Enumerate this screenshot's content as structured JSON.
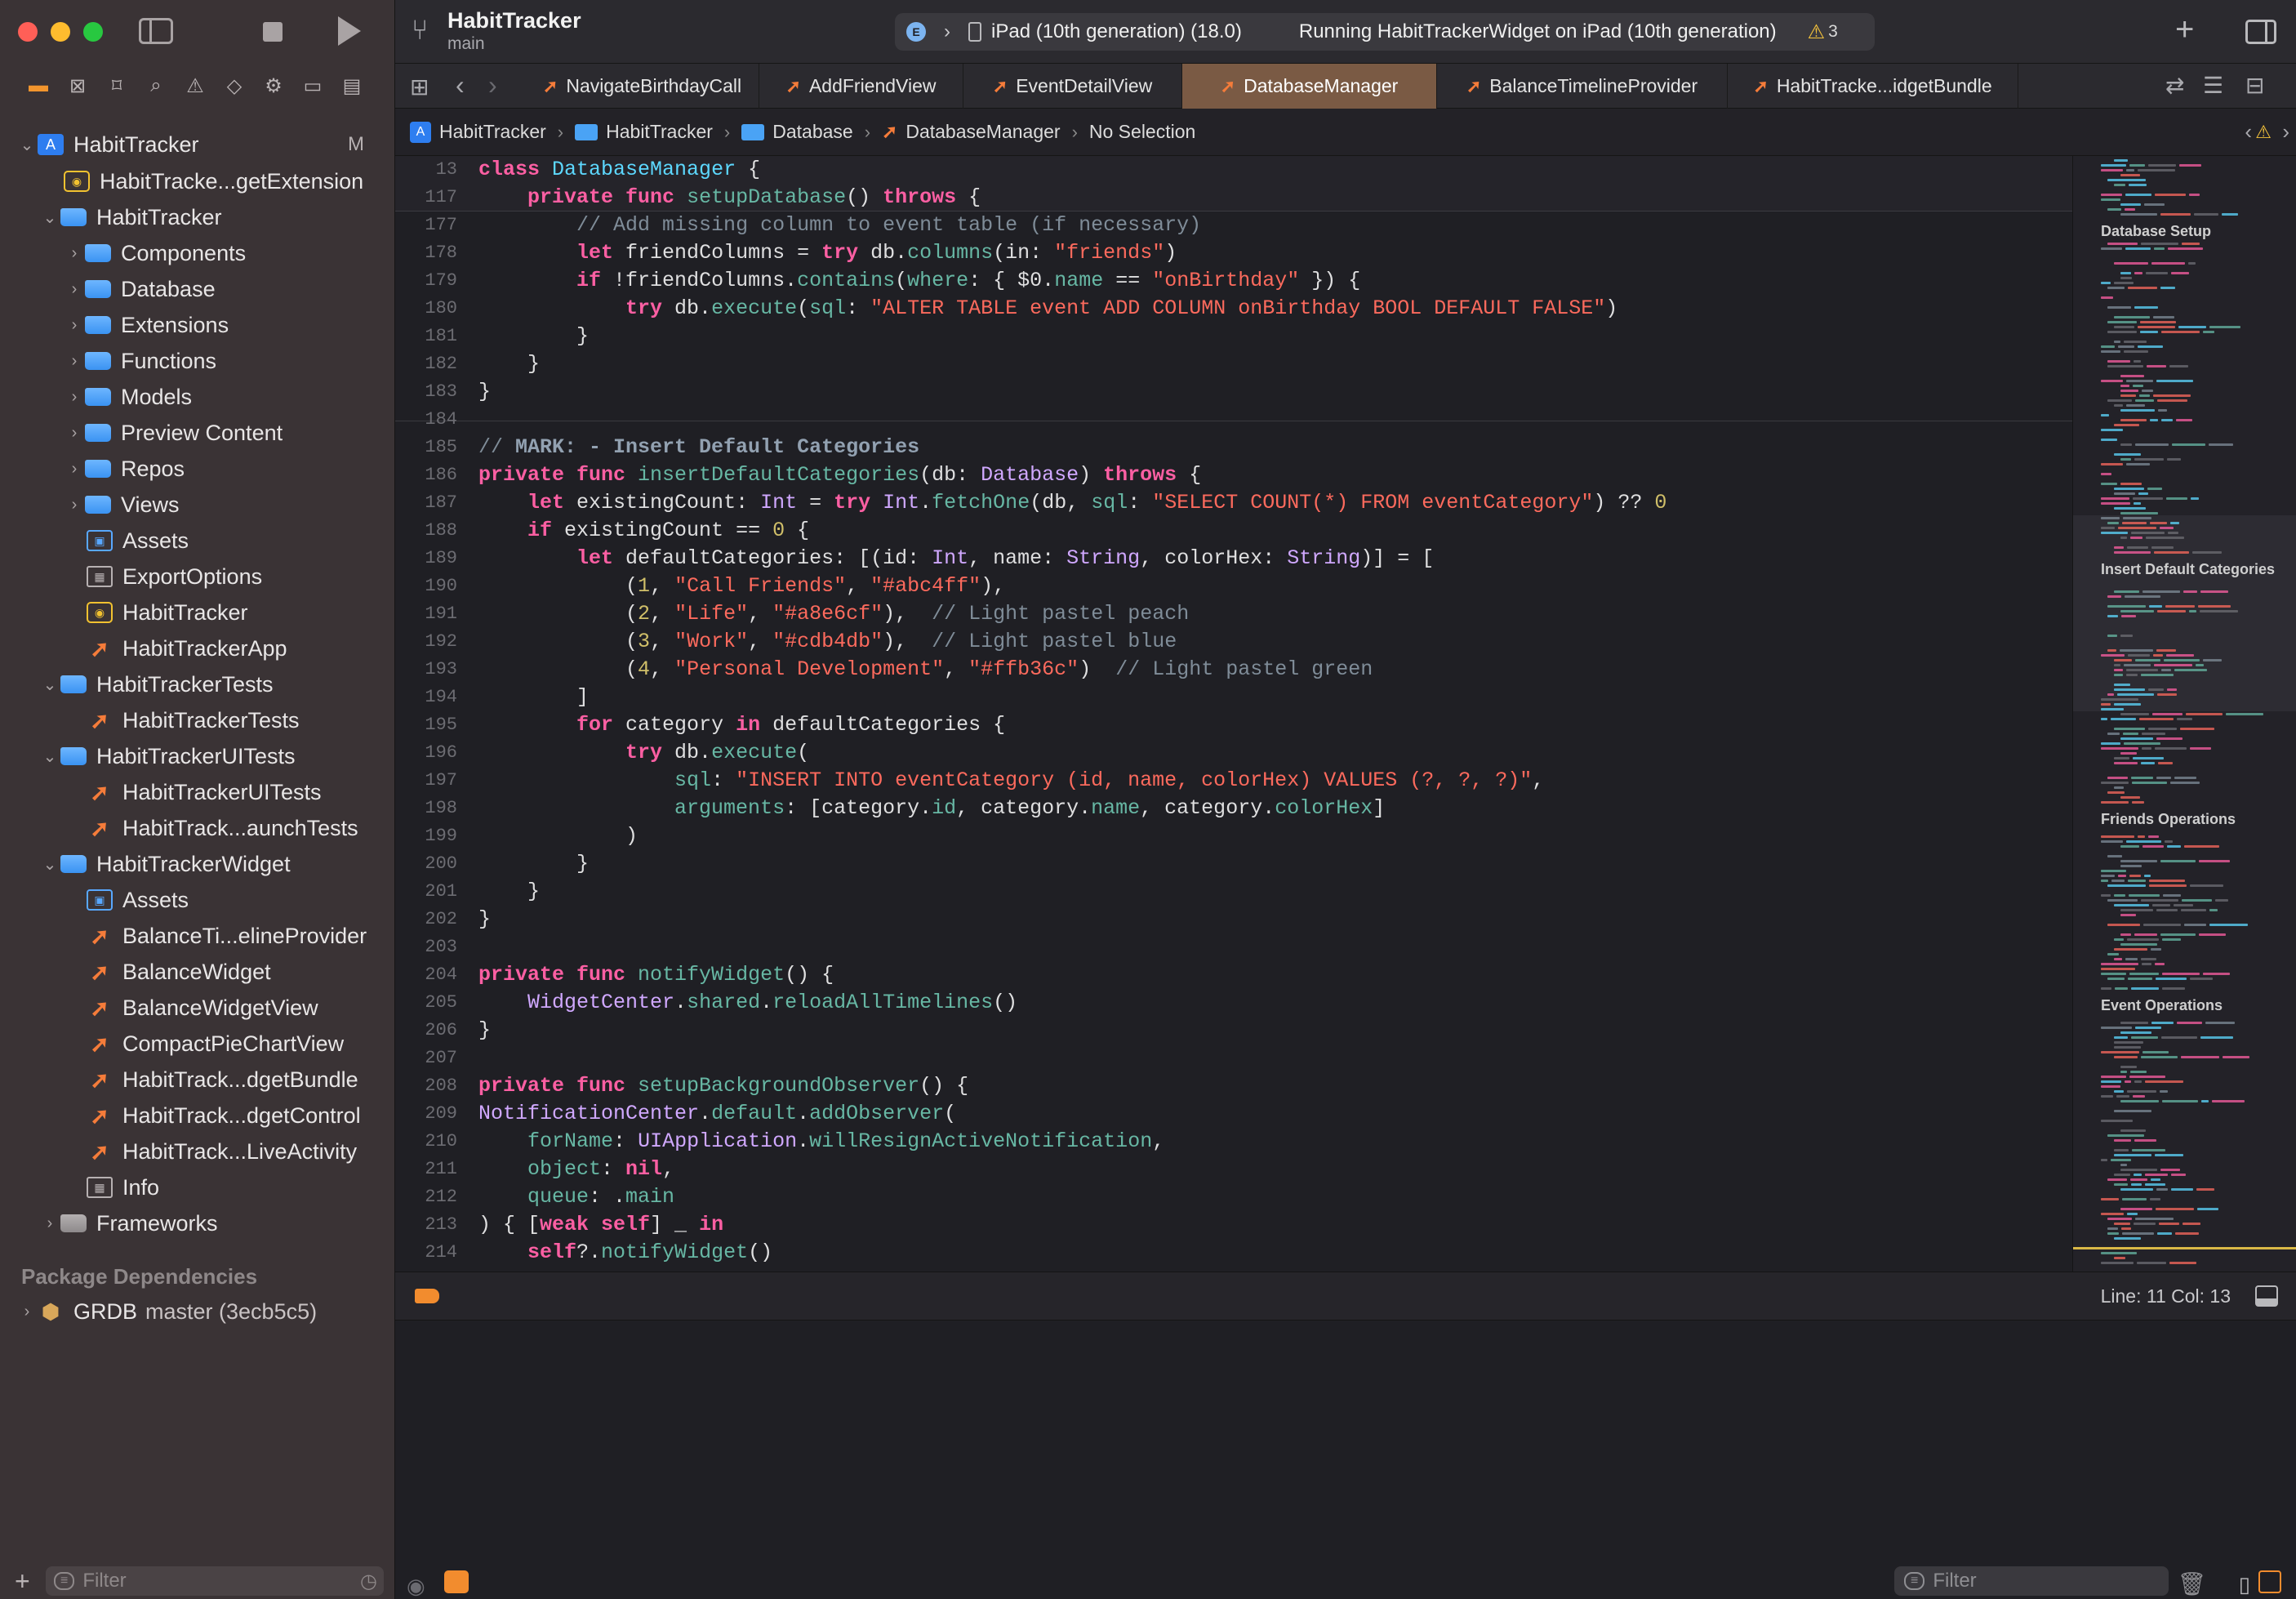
{
  "app": {
    "project_name": "HabitTracker",
    "branch": "main",
    "run_destination": "iPad (10th generation) (18.0)",
    "run_status": "Running HabitTrackerWidget on iPad (10th generation)",
    "warning_count": "3",
    "scheme_badge": "E"
  },
  "tabs": [
    {
      "label": "NavigateBirthdayCall"
    },
    {
      "label": "AddFriendView"
    },
    {
      "label": "EventDetailView"
    },
    {
      "label": "DatabaseManager"
    },
    {
      "label": "BalanceTimelineProvider"
    },
    {
      "label": "HabitTracke...idgetBundle"
    }
  ],
  "breadcrumb": [
    "HabitTracker",
    "HabitTracker",
    "Database",
    "DatabaseManager",
    "No Selection"
  ],
  "sidebar": {
    "items": [
      {
        "label": "HabitTracker",
        "badge": "M"
      },
      {
        "label": "HabitTracke...getExtension"
      },
      {
        "label": "HabitTracker"
      },
      {
        "label": "Components"
      },
      {
        "label": "Database"
      },
      {
        "label": "Extensions"
      },
      {
        "label": "Functions"
      },
      {
        "label": "Models"
      },
      {
        "label": "Preview Content"
      },
      {
        "label": "Repos"
      },
      {
        "label": "Views"
      },
      {
        "label": "Assets"
      },
      {
        "label": "ExportOptions"
      },
      {
        "label": "HabitTracker"
      },
      {
        "label": "HabitTrackerApp"
      },
      {
        "label": "HabitTrackerTests"
      },
      {
        "label": "HabitTrackerTests"
      },
      {
        "label": "HabitTrackerUITests"
      },
      {
        "label": "HabitTrackerUITests"
      },
      {
        "label": "HabitTrack...aunchTests"
      },
      {
        "label": "HabitTrackerWidget"
      },
      {
        "label": "Assets"
      },
      {
        "label": "BalanceTi...elineProvider"
      },
      {
        "label": "BalanceWidget"
      },
      {
        "label": "BalanceWidgetView"
      },
      {
        "label": "CompactPieChartView"
      },
      {
        "label": "HabitTrack...dgetBundle"
      },
      {
        "label": "HabitTrack...dgetControl"
      },
      {
        "label": "HabitTrack...LiveActivity"
      },
      {
        "label": "Info"
      },
      {
        "label": "Frameworks"
      }
    ],
    "package_dependencies_title": "Package Dependencies",
    "package": {
      "name": "GRDB",
      "version": "master (3ecb5c5)"
    },
    "filter_placeholder": "Filter"
  },
  "minimap": {
    "sections": [
      "Database Setup",
      "Insert Default Categories",
      "Friends Operations",
      "Event Operations"
    ]
  },
  "status": {
    "cursor": "Line: 11  Col: 13"
  },
  "debug": {
    "filter_placeholder": "Filter"
  },
  "code": {
    "sticky": [
      {
        "n": "13",
        "text": "class DatabaseManager {"
      },
      {
        "n": "117",
        "text": "    private func setupDatabase() throws {"
      }
    ],
    "lines": [
      {
        "n": "177",
        "text": "        // Add missing column to event table (if necessary)"
      },
      {
        "n": "178",
        "text": "        let friendColumns = try db.columns(in: \"friends\")"
      },
      {
        "n": "179",
        "text": "        if !friendColumns.contains(where: { $0.name == \"onBirthday\" }) {"
      },
      {
        "n": "180",
        "text": "            try db.execute(sql: \"ALTER TABLE event ADD COLUMN onBirthday BOOL DEFAULT FALSE\")"
      },
      {
        "n": "181",
        "text": "        }"
      },
      {
        "n": "182",
        "text": "    }"
      },
      {
        "n": "183",
        "text": "}"
      },
      {
        "n": "184",
        "text": ""
      },
      {
        "n": "185",
        "text": "// MARK: - Insert Default Categories"
      },
      {
        "n": "186",
        "text": "private func insertDefaultCategories(db: Database) throws {"
      },
      {
        "n": "187",
        "text": "    let existingCount: Int = try Int.fetchOne(db, sql: \"SELECT COUNT(*) FROM eventCategory\") ?? 0"
      },
      {
        "n": "188",
        "text": "    if existingCount == 0 {"
      },
      {
        "n": "189",
        "text": "        let defaultCategories: [(id: Int, name: String, colorHex: String)] = ["
      },
      {
        "n": "190",
        "text": "            (1, \"Call Friends\", \"#abc4ff\"),"
      },
      {
        "n": "191",
        "text": "            (2, \"Life\", \"#a8e6cf\"),  // Light pastel peach"
      },
      {
        "n": "192",
        "text": "            (3, \"Work\", \"#cdb4db\"),  // Light pastel blue"
      },
      {
        "n": "193",
        "text": "            (4, \"Personal Development\", \"#ffb36c\")  // Light pastel green"
      },
      {
        "n": "194",
        "text": "        ]"
      },
      {
        "n": "195",
        "text": "        for category in defaultCategories {"
      },
      {
        "n": "196",
        "text": "            try db.execute("
      },
      {
        "n": "197",
        "text": "                sql: \"INSERT INTO eventCategory (id, name, colorHex) VALUES (?, ?, ?)\","
      },
      {
        "n": "198",
        "text": "                arguments: [category.id, category.name, category.colorHex]"
      },
      {
        "n": "199",
        "text": "            )"
      },
      {
        "n": "200",
        "text": "        }"
      },
      {
        "n": "201",
        "text": "    }"
      },
      {
        "n": "202",
        "text": "}"
      },
      {
        "n": "203",
        "text": ""
      },
      {
        "n": "204",
        "text": "private func notifyWidget() {"
      },
      {
        "n": "205",
        "text": "    WidgetCenter.shared.reloadAllTimelines()"
      },
      {
        "n": "206",
        "text": "}"
      },
      {
        "n": "207",
        "text": ""
      },
      {
        "n": "208",
        "text": "private func setupBackgroundObserver() {"
      },
      {
        "n": "209",
        "text": "NotificationCenter.default.addObserver("
      },
      {
        "n": "210",
        "text": "    forName: UIApplication.willResignActiveNotification,"
      },
      {
        "n": "211",
        "text": "    object: nil,"
      },
      {
        "n": "212",
        "text": "    queue: .main"
      },
      {
        "n": "213",
        "text": ") { [weak self] _ in"
      },
      {
        "n": "214",
        "text": "    self?.notifyWidget()"
      }
    ]
  },
  "colors": {
    "keyword": "#fc5fa3",
    "type": "#5dd8ff",
    "string": "#fc6a5d",
    "number": "#d0bf69",
    "comment": "#7f8c98",
    "active_tab": "#7a5a44",
    "warning": "#f5c33b"
  }
}
